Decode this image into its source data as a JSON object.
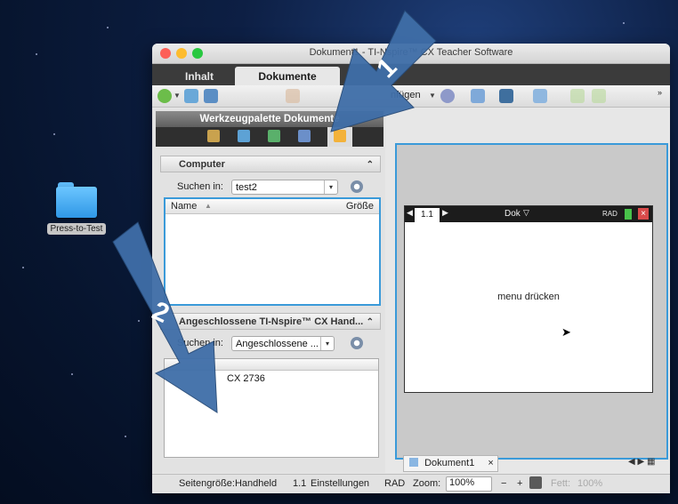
{
  "desktop": {
    "icon_label": "Press-to-Test"
  },
  "window": {
    "title": "Dokument1 - TI-Nspire™ CX Teacher Software",
    "tabs": [
      {
        "label": "Inhalt"
      },
      {
        "label": "Dokumente"
      }
    ]
  },
  "toolbar": {
    "insert_label": "nfügen"
  },
  "palette": {
    "title": "Werkzeugpalette Dokumente"
  },
  "computer": {
    "header": "Computer",
    "search_label": "Suchen in:",
    "search_value": "test2",
    "col_name": "Name",
    "col_size": "Größe"
  },
  "handhelds": {
    "header": "Angeschlossene TI-Nspire™ CX Hand...",
    "search_label": "Suchen in:",
    "search_value": "Angeschlossene ...",
    "device": "CX 2736"
  },
  "calculator": {
    "page_tab": "1.1",
    "doc_title": "Dok",
    "mode": "RAD",
    "message": "menu drücken"
  },
  "doc_tab": {
    "label": "Dokument1",
    "close": "×"
  },
  "status": {
    "page_size": "Seitengröße:Handheld",
    "page": "1.1",
    "settings": "Einstellungen",
    "mode": "RAD",
    "zoom_label": "Zoom:",
    "zoom_value": "100%",
    "fett_label": "Fett:",
    "fett_value": "100%"
  },
  "arrows": {
    "first": "1",
    "second": "2"
  },
  "colors": {
    "arrow_blue": "#3f6ea8",
    "focus_blue": "#3a9ad9"
  }
}
